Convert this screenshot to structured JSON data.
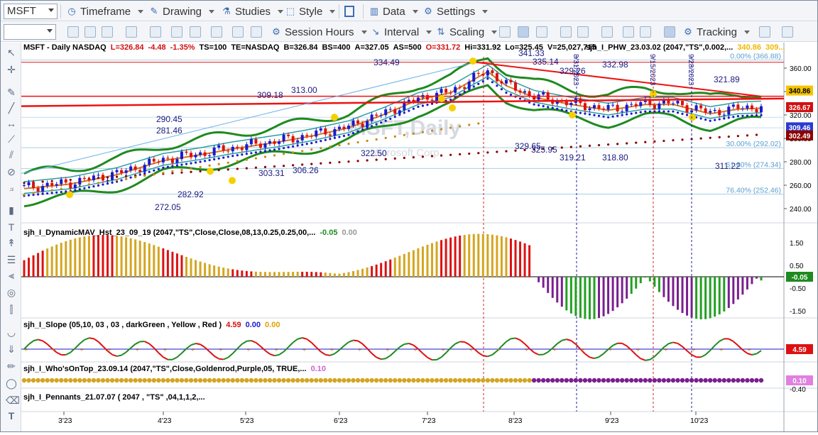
{
  "toolbar1": {
    "symbol": "MSFT",
    "timeframe": "Timeframe",
    "drawing": "Drawing",
    "studies": "Studies",
    "style": "Style",
    "data": "Data",
    "settings": "Settings"
  },
  "toolbar2": {
    "session_hours": "Session Hours",
    "interval": "Interval",
    "scaling": "Scaling",
    "tracking": "Tracking"
  },
  "main_panel": {
    "symbol_label": "MSFT - Daily  NASDAQ",
    "last": "L=326.84",
    "change": "-4.48",
    "change_pct": "-1.35%",
    "ts": "TS=100",
    "te": "TE=NASDAQ",
    "bid": "B=326.84",
    "bidsize": "BS=400",
    "ask": "A=327.05",
    "asksize": "AS=500",
    "open": "O=331.72",
    "high": "Hi=331.92",
    "low": "Lo=325.45",
    "volume": "V=25,027,715",
    "study": "sjh_I_PHW_23.03.02 (2047,\"TS\",0.002,...",
    "study_val1": "340.86",
    "study_val2": "309...",
    "watermark_title": "MSFT,Daily",
    "watermark_company": "Microsoft Corp",
    "price_axis": [
      "360.00",
      "340.00",
      "320.00",
      "300.00",
      "280.00",
      "260.00",
      "240.00"
    ],
    "price_tags": [
      {
        "text": "340.86",
        "color": "#f5c400",
        "fg": "#000"
      },
      {
        "text": "326.67",
        "color": "#d01010",
        "fg": "#fff"
      },
      {
        "text": "309.46",
        "color": "#2a3bd0",
        "fg": "#fff"
      },
      {
        "text": "302.49",
        "color": "#8b0000",
        "fg": "#fff"
      }
    ],
    "fib_labels": [
      {
        "text": "0.00% (366.88)"
      },
      {
        "text": "30.00% (292.02)"
      },
      {
        "text": "61.80% (274.34)"
      },
      {
        "text": "76.40% (252.46)"
      }
    ],
    "price_labels": [
      "341.33",
      "334.49",
      "335.14",
      "329.26",
      "332.98",
      "321.89",
      "309.18",
      "313.00",
      "290.45",
      "281.46",
      "329.65",
      "325.95",
      "322.50",
      "319.21",
      "318.80",
      "303.31",
      "306.26",
      "311.22",
      "282.92",
      "272.05"
    ],
    "date_labels": [
      "8/31/2023",
      "9/15/2023",
      "9/28/2023"
    ]
  },
  "dynamicmav_panel": {
    "title": "sjh_I_DynamicMAV_Hst_23_09_19 (2047,\"TS\",Close,Close,08,13,0.25,0.25,00,...",
    "val1": "-0.05",
    "val2": "0.00",
    "axis": [
      "1.50",
      "0.50",
      "-0.50",
      "-1.50"
    ],
    "tag": "-0.05"
  },
  "slope_panel": {
    "title": "sjh_I_Slope (05,10, 03 , 03 , darkGreen , Yellow , Red )",
    "val1": "4.59",
    "val2": "0.00",
    "val3": "0.00",
    "tag": "4.59"
  },
  "whosontop_panel": {
    "title": "sjh_I_Who'sOnTop_23.09.14 (2047,\"TS\",Close,Goldenrod,Purple,05,  TRUE,...",
    "val1": "0.10",
    "tag": "0.10",
    "tag2": "-0.40"
  },
  "pennants_panel": {
    "title": "sjh_I_Pennants_21.07.07 (  2047 ,  \"TS\" ,04,1,1,2,..."
  },
  "time_axis": [
    "3'23",
    "4'23",
    "5'23",
    "6'23",
    "7'23",
    "8'23",
    "9'23",
    "10'23"
  ],
  "colors": {
    "up": "#1a1acc",
    "down": "#dd1111",
    "band": "#1f8a1f",
    "fib": "#a9cfe8",
    "resistance": "#ee1111",
    "hist_gold": "#d4a520",
    "hist_red": "#dd1111",
    "hist_purple": "#7a1f8f",
    "hist_green": "#22a022",
    "whos_gold": "#d4a520",
    "whos_purple": "#7a1f8f"
  }
}
